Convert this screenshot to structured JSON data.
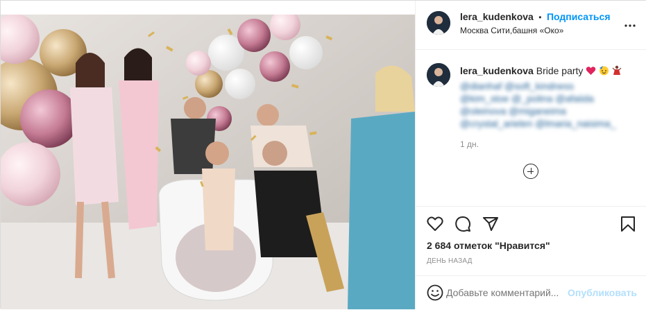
{
  "post": {
    "photo_alt": "Bride party photo",
    "colors": {
      "accent": "#0095f6",
      "publish_disabled": "#b2dffc",
      "muted": "#8e8e8e",
      "text": "#262626"
    }
  },
  "header": {
    "username": "lera_kudenkova",
    "dot": "•",
    "follow_label": "Подписаться",
    "location": "Москва Сити,башня «Око»",
    "more_icon": "more-icon"
  },
  "caption": {
    "username": "lera_kudenkova",
    "text": "Bride party",
    "emojis": [
      "heart-icon",
      "party-face-icon",
      "dancer-icon"
    ],
    "blurred_lines": [
      "@dianhaf @soft_kindness",
      "@kim_stoe @_polina @afaiida",
      "@oleinova @miganeima",
      "@crystal_arielen @lmaria_naisima_"
    ],
    "time": "1 дн."
  },
  "actions": {
    "like_icon": "heart-outline-icon",
    "comment_icon": "comment-icon",
    "share_icon": "send-icon",
    "save_icon": "bookmark-icon"
  },
  "likes": {
    "count": "2 684",
    "label": "отметок",
    "quote": "\"Нравится\""
  },
  "date_label": "День назад",
  "comment_box": {
    "placeholder": "Добавьте комментарий...",
    "publish_label": "Опубликовать",
    "emoji_icon": "smiley-icon"
  }
}
